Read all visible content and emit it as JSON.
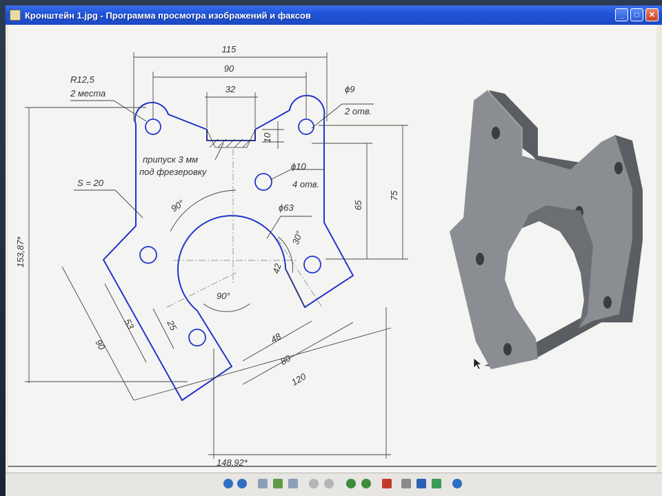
{
  "window": {
    "title": "Кронштейн 1.jpg - Программа просмотра изображений и факсов",
    "controls": {
      "minimize": "_",
      "maximize": "□",
      "close": "✕"
    }
  },
  "drawing": {
    "dims": {
      "d115": "115",
      "d90": "90",
      "d32": "32",
      "r125": "R12,5",
      "r125_note": "2 места",
      "phi9": "ϕ9",
      "phi9_note": "2 отв.",
      "d10": "10",
      "allowance_line1": "припуск 3 мм",
      "allowance_line2": "под фрезеровку",
      "phi10": "ϕ10",
      "phi10_note": "4 отв.",
      "s20": "S = 20",
      "phi63": "ϕ63",
      "a90_top": "90°",
      "a30": "30°",
      "d42": "42",
      "a90_bottom": "90°",
      "d65": "65",
      "d75": "75",
      "d15387": "153,87*",
      "d53": "53",
      "d25": "25",
      "d48": "48",
      "d80": "80",
      "d120": "120",
      "d90_left": "90",
      "d14892": "148,92*"
    }
  },
  "statusbar": {
    "icons": [
      "prev-icon",
      "next-icon",
      "best-fit-icon",
      "actual-size-icon",
      "slideshow-icon",
      "zoom-in-icon",
      "zoom-out-icon",
      "rotate-cw-icon",
      "rotate-ccw-icon",
      "delete-icon",
      "print-icon",
      "save-icon",
      "edit-icon",
      "help-icon"
    ]
  }
}
